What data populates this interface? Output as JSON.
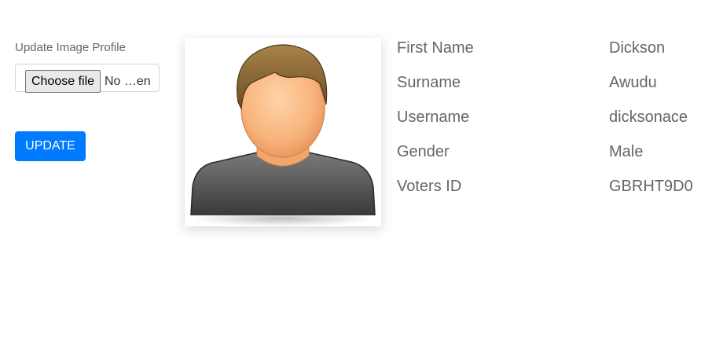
{
  "upload": {
    "label": "Update Image Profile",
    "choose_file_label": "Choose file",
    "file_status": "No …en",
    "submit_label": "UPDATE"
  },
  "avatar": {
    "icon": "default-user-avatar-icon"
  },
  "profile": {
    "rows": [
      {
        "label": "First Name",
        "value": "Dickson"
      },
      {
        "label": "Surname",
        "value": "Awudu"
      },
      {
        "label": "Username",
        "value": "dicksonace"
      },
      {
        "label": "Gender",
        "value": "Male"
      },
      {
        "label": "Voters ID",
        "value": "GBRHT9D0"
      }
    ]
  },
  "colors": {
    "primary": "#007bff",
    "text_muted": "#666666"
  }
}
